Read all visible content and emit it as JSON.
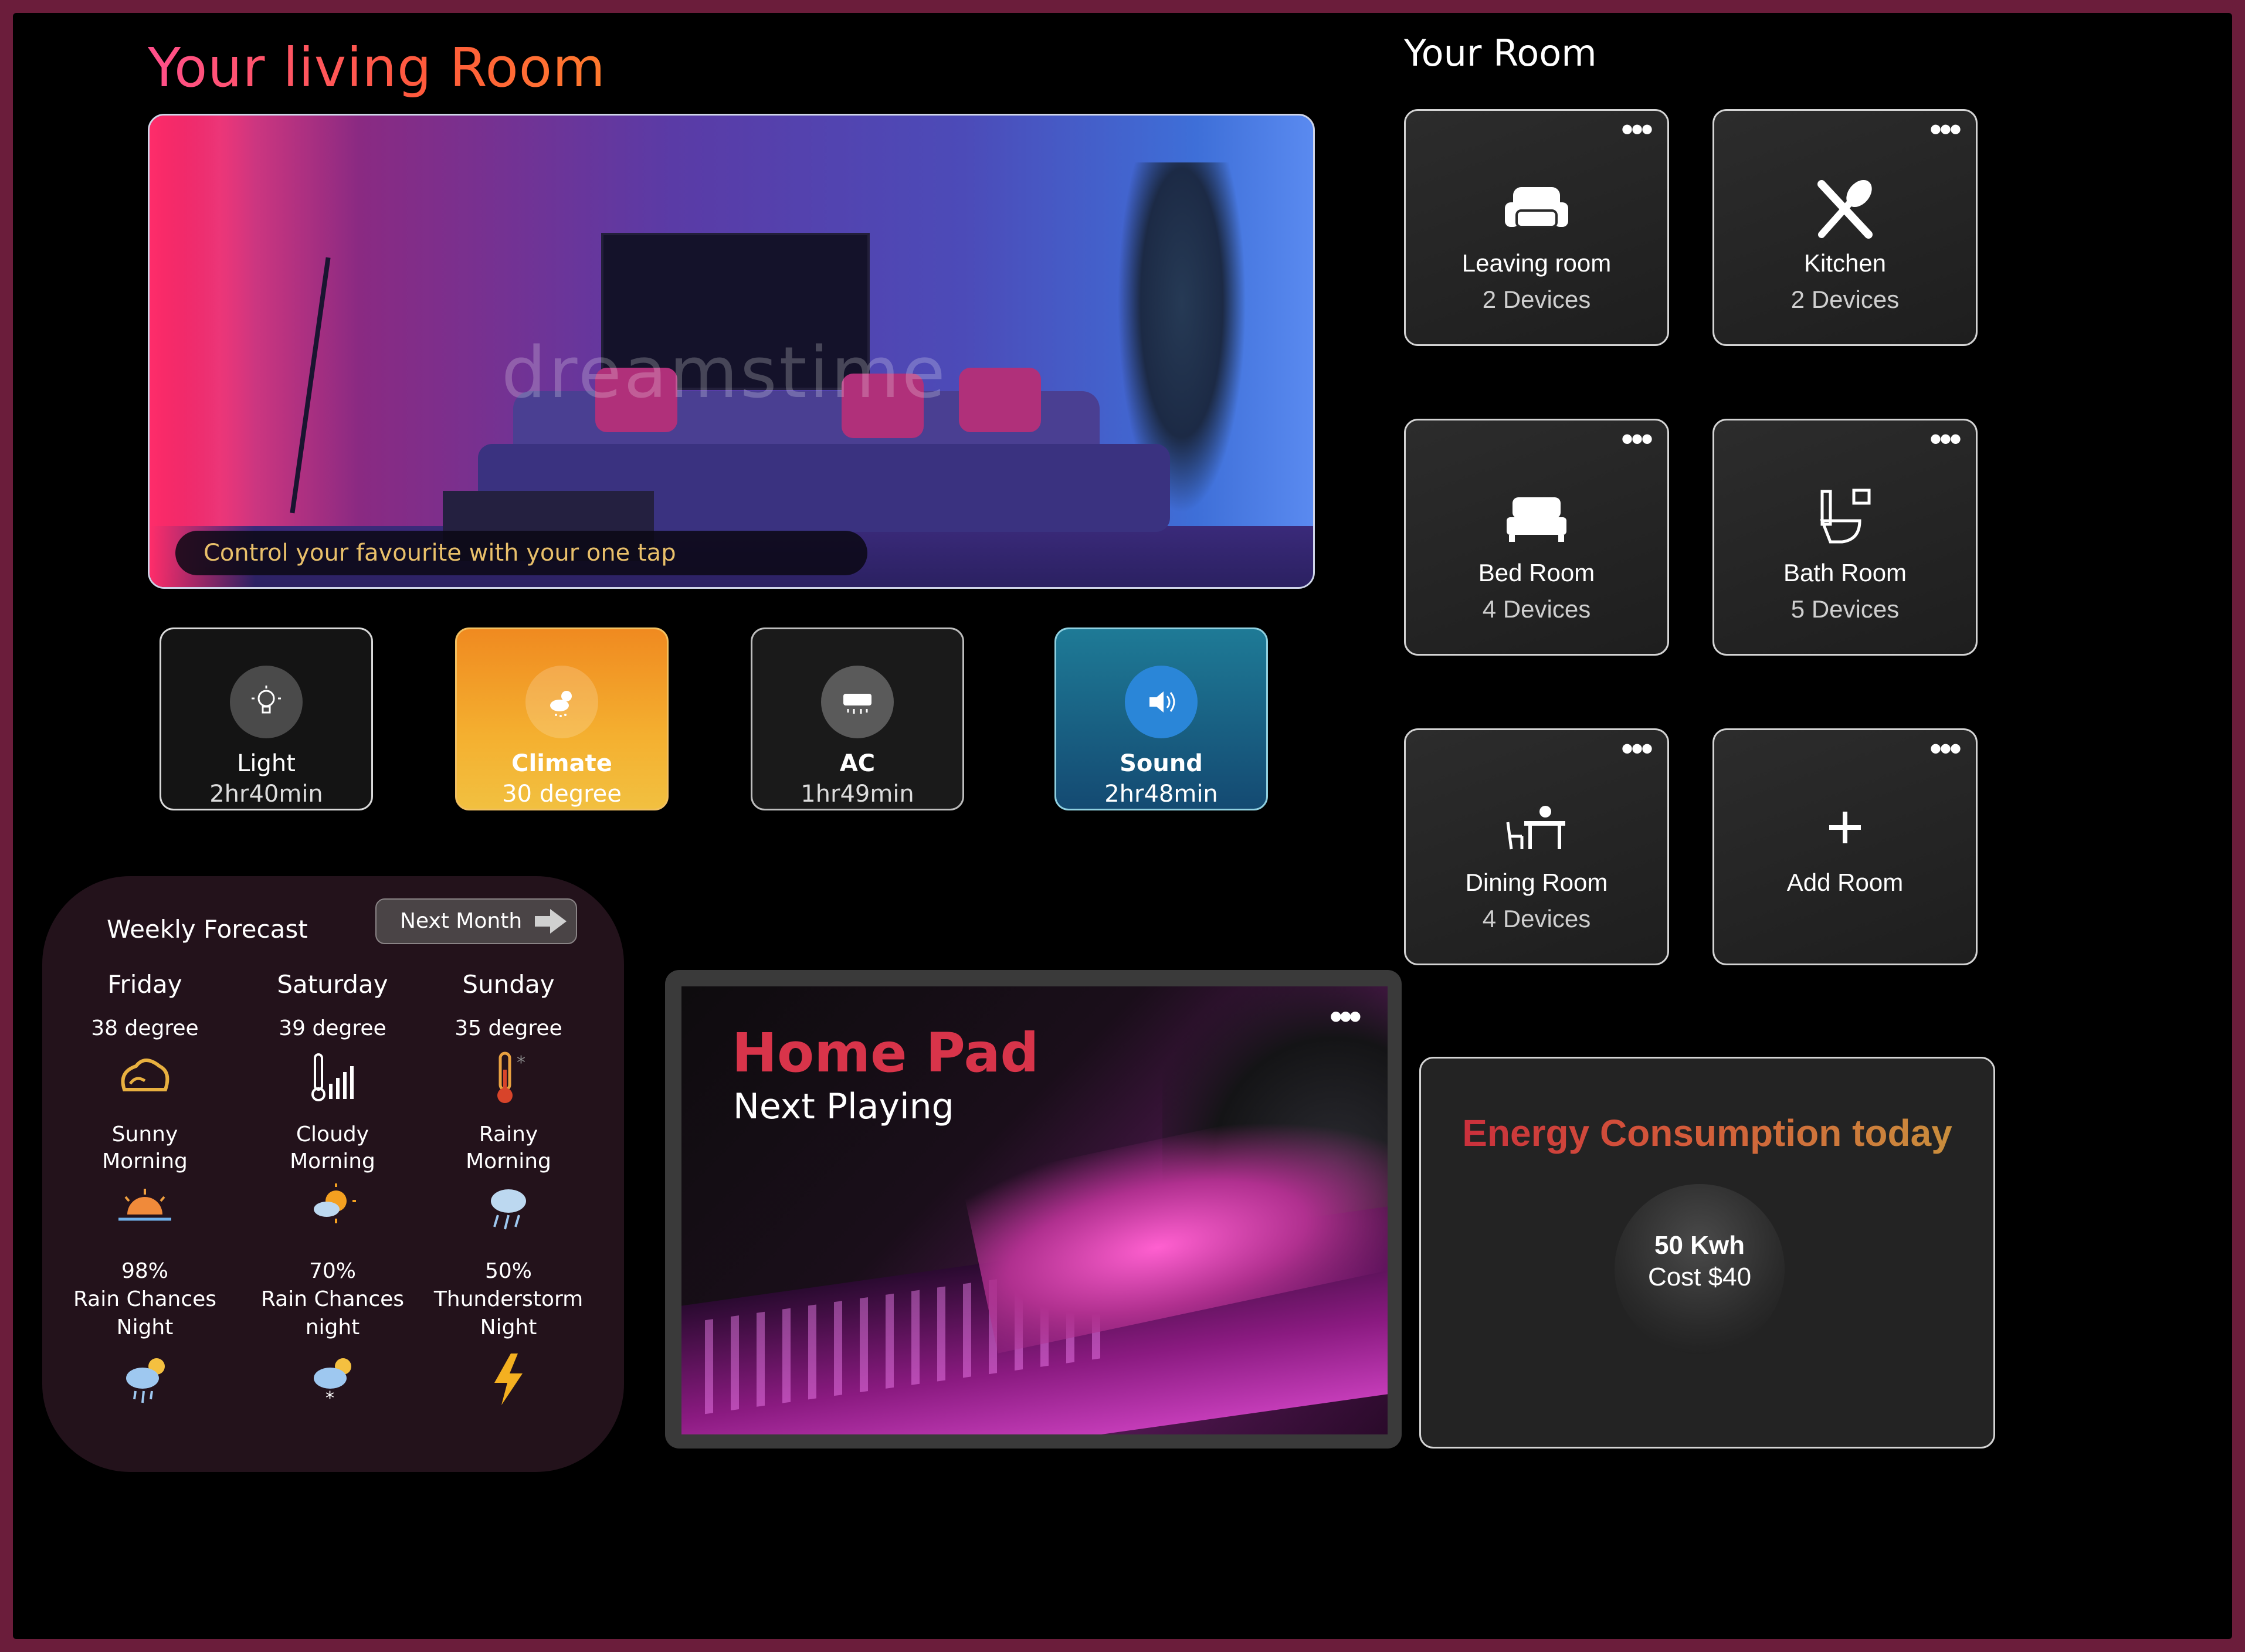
{
  "header": {
    "title": "Your living Room"
  },
  "hero": {
    "watermark": "dreamstime",
    "caption": "Control your favourite with your one tap"
  },
  "devices": [
    {
      "name": "Light",
      "value": "2hr40min",
      "icon": "lightbulb-icon"
    },
    {
      "name": "Climate",
      "value": "30 degree",
      "icon": "weather-icon"
    },
    {
      "name": "AC",
      "value": "1hr49min",
      "icon": "ac-icon"
    },
    {
      "name": "Sound",
      "value": "2hr48min",
      "icon": "speaker-icon"
    }
  ],
  "forecast": {
    "title": "Weekly Forecast",
    "next_button": "Next Month",
    "days": [
      {
        "day": "Friday",
        "degree": "38 degree",
        "condition": "Sunny\nMorning",
        "rain_pct": "98%",
        "rain_label": "Rain Chances",
        "rain_time": "Night"
      },
      {
        "day": "Saturday",
        "degree": "39 degree",
        "condition": "Cloudy\nMorning",
        "rain_pct": "70%",
        "rain_label": "Rain Chances",
        "rain_time": "night"
      },
      {
        "day": "Sunday",
        "degree": "35 degree",
        "condition": "Rainy\nMorning",
        "rain_pct": "50%",
        "rain_label": "Thunderstorm",
        "rain_time": "Night"
      }
    ]
  },
  "home_pad": {
    "title": "Home Pad",
    "subtitle": "Next Playing"
  },
  "rooms": {
    "title": "Your Room",
    "items": [
      {
        "name": "Leaving room",
        "devices": "2 Devices",
        "icon": "sofa-icon"
      },
      {
        "name": "Kitchen",
        "devices": "2 Devices",
        "icon": "utensils-icon"
      },
      {
        "name": "Bed Room",
        "devices": "4 Devices",
        "icon": "bed-icon"
      },
      {
        "name": "Bath Room",
        "devices": "5 Devices",
        "icon": "toilet-icon"
      },
      {
        "name": "Dining Room",
        "devices": "4 Devices",
        "icon": "dining-icon"
      },
      {
        "name": "Add Room",
        "devices": "",
        "icon": "plus-icon"
      }
    ]
  },
  "energy": {
    "title": "Energy Consumption today",
    "usage": "50 Kwh",
    "cost": "Cost $40"
  },
  "colors": {
    "accent_pink": "#ff4f8b",
    "climate_orange": "#f0a020",
    "sound_teal": "#1b6e8f",
    "pad_red": "#d8344a"
  }
}
